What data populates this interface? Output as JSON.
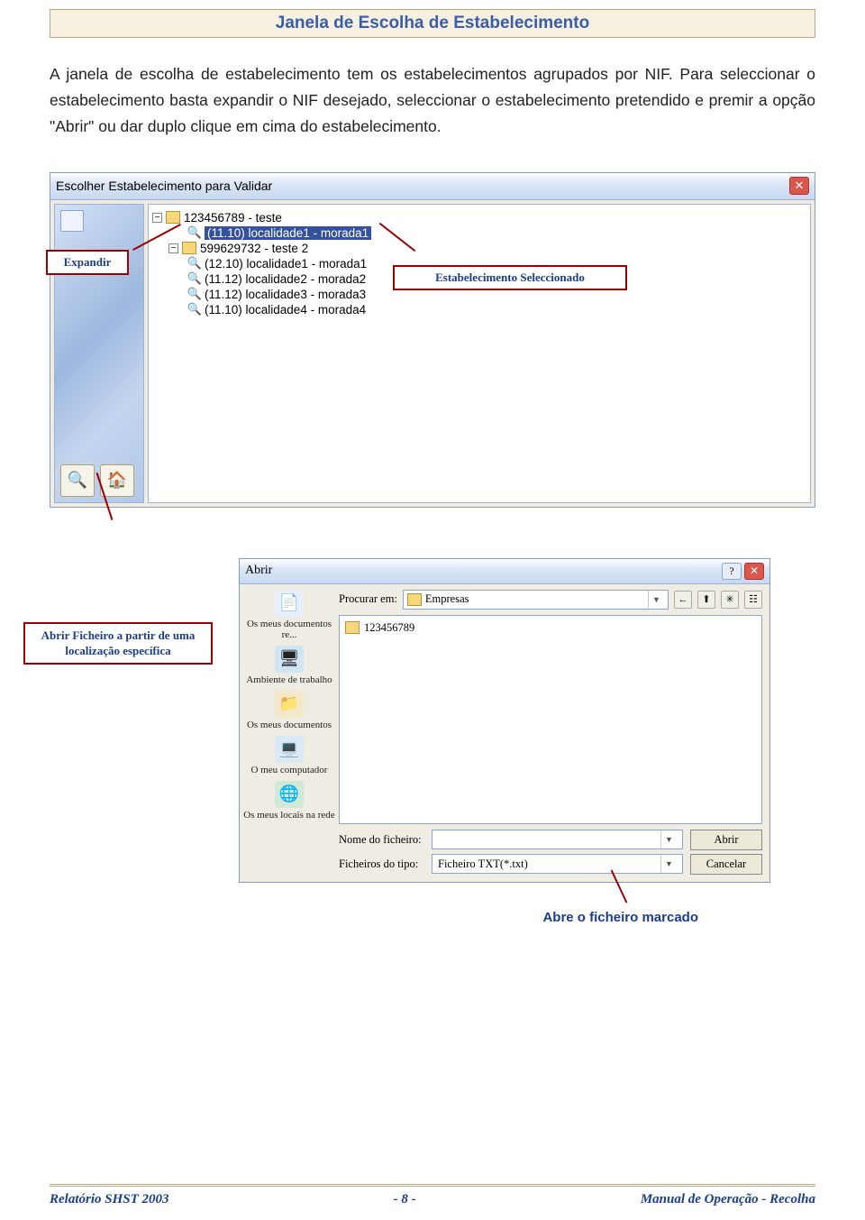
{
  "title": "Janela de Escolha de Estabelecimento",
  "intro": "A janela de escolha de estabelecimento tem os estabelecimentos agrupados por NIF. Para seleccionar o estabelecimento basta expandir o NIF desejado, seleccionar o estabelecimento pretendido e premir a opção \"Abrir\" ou dar duplo clique em cima do estabelecimento.",
  "dialog1": {
    "title": "Escolher Estabelecimento para Validar",
    "tree": {
      "n1": "123456789 - teste",
      "n1_sel": "(11.10) localidade1 - morada1",
      "n2": "599629732 - teste 2",
      "c1": "(12.10) localidade1 - morada1",
      "c2": "(11.12) localidade2 - morada2",
      "c3": "(11.12) localidade3 - morada3",
      "c4": "(11.10) localidade4 - morada4"
    }
  },
  "callouts": {
    "expandir": "Expandir",
    "selecionado": "Estabelecimento Seleccionado",
    "abrir_fich": "Abrir Ficheiro a partir de uma localização específica",
    "abre_marcado": "Abre o ficheiro marcado"
  },
  "dialog2": {
    "title": "Abrir",
    "lookin_label": "Procurar em:",
    "lookin_value": "Empresas",
    "list_item": "123456789",
    "places": {
      "p1": "Os meus documentos re...",
      "p2": "Ambiente de trabalho",
      "p3": "Os meus documentos",
      "p4": "O meu computador",
      "p5": "Os meus locais na rede"
    },
    "filename_label": "Nome do ficheiro:",
    "filetype_label": "Ficheiros do tipo:",
    "filetype_value": "Ficheiro TXT(*.txt)",
    "btn_open": "Abrir",
    "btn_cancel": "Cancelar"
  },
  "footer": {
    "left": "Relatório SHST 2003",
    "center": "- 8 -",
    "right": "Manual de Operação - Recolha"
  }
}
